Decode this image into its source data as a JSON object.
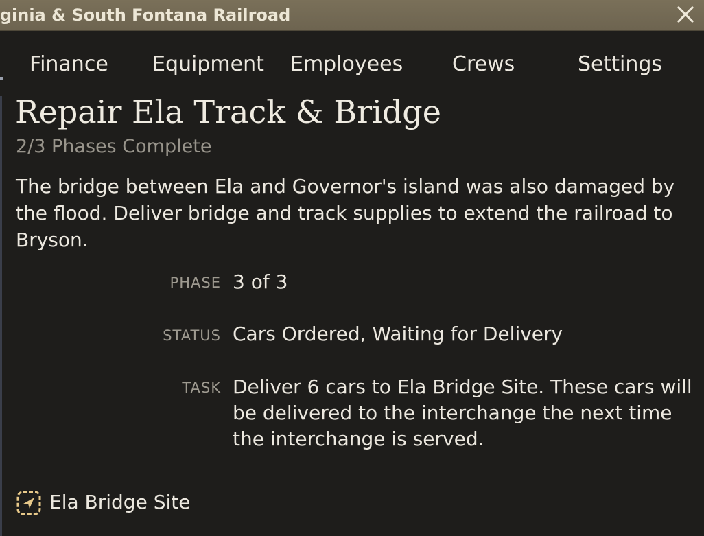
{
  "window": {
    "title": "rginia & South Fontana Railroad",
    "close_icon": "close-x-icon"
  },
  "tabs": [
    {
      "label": "Finance"
    },
    {
      "label": "Equipment"
    },
    {
      "label": "Employees"
    },
    {
      "label": "Crews"
    },
    {
      "label": "Settings"
    }
  ],
  "project": {
    "title": "Repair Ela Track & Bridge",
    "progress": "2/3 Phases Complete",
    "description": "The bridge between Ela and Governor's island was also damaged by the flood. Deliver bridge and track supplies to extend the railroad to Bryson."
  },
  "fields": {
    "phase_label": "PHASE",
    "phase_value": "3 of 3",
    "status_label": "STATUS",
    "status_value": "Cars Ordered, Waiting for Delivery",
    "task_label": "TASK",
    "task_value": "Deliver 6 cars to Ela Bridge Site. These cars will be delivered to the interchange the next time the interchange is served."
  },
  "location": {
    "icon": "locate-arrow-icon",
    "label": "Ela Bridge Site"
  },
  "colors": {
    "titlebar": "#736a55",
    "background": "#1e1d1b",
    "text": "#ece8df",
    "muted": "#98948b",
    "location_icon": "#e8c98a"
  }
}
